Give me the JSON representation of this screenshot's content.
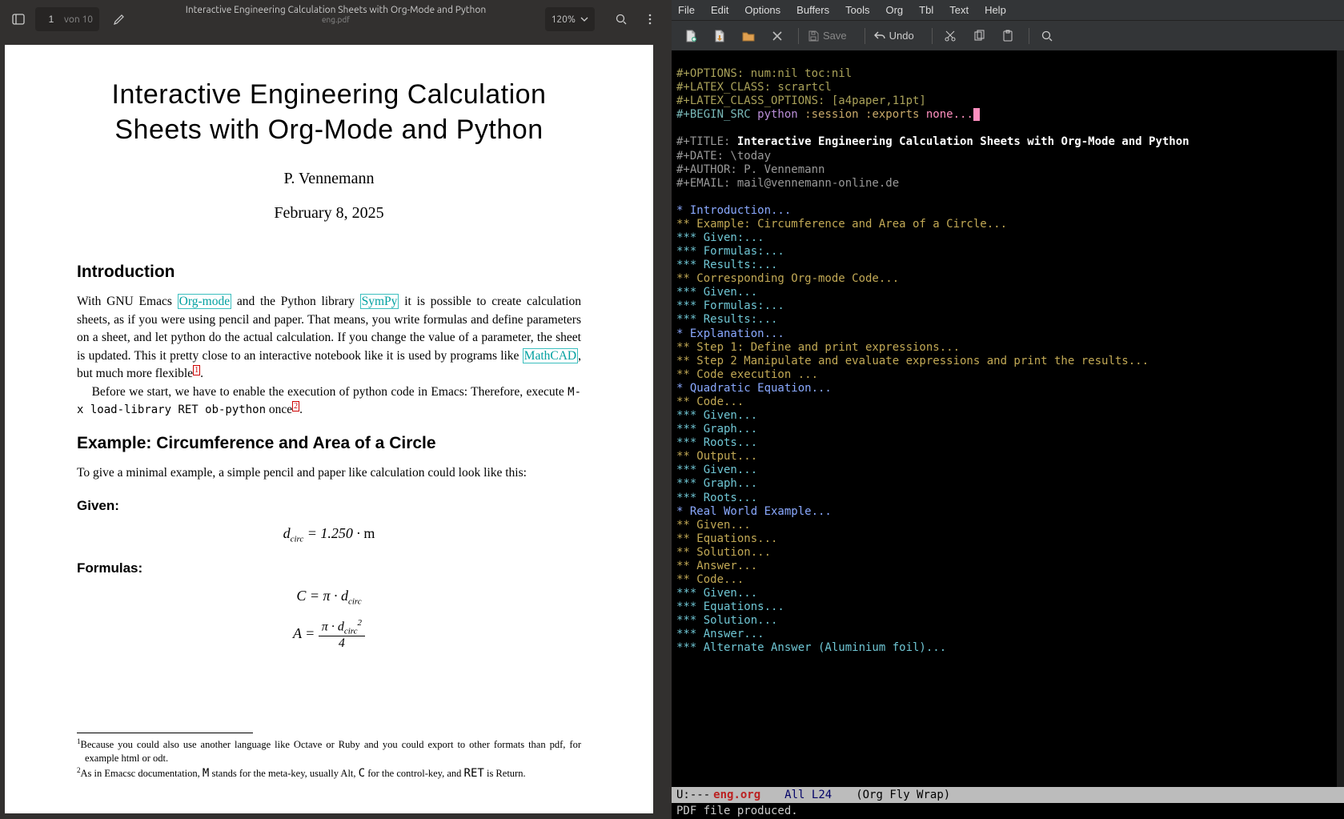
{
  "pdf": {
    "page_current": "1",
    "page_label": "von 10",
    "title": "Interactive Engineering Calculation Sheets with Org-Mode and Python",
    "filename": "eng.pdf",
    "zoom": "120%",
    "doc": {
      "title": "Interactive Engineering Calculation Sheets with Org-Mode and Python",
      "author": "P. Vennemann",
      "date": "February 8, 2025",
      "h_intro": "Introduction",
      "intro_p1_pre": "With GNU Emacs ",
      "link_org": "Org-mode",
      "intro_p1_mid": " and the Python library ",
      "link_sympy": "SymPy",
      "intro_p1_post": " it is possible to create calculation sheets, as if you were using pencil and paper. That means, you write formulas and define parameters on a sheet, and let python do the actual calculation. If you change the value of a parameter, the sheet is updated. This it pretty close to an interactive notebook like it is used by programs like ",
      "link_mathcad": "MathCAD",
      "intro_p1_tail": ", but much more flexible",
      "intro_p2": "Before we start, we have to enable the execution of python code in Emacs: Therefore, execute ",
      "intro_cmd": "M-x load-library RET ob-python",
      "intro_p2_tail": " once",
      "h_example": "Example: Circumference and Area of a Circle",
      "example_p": "To give a minimal example, a simple pencil and paper like calculation could look like this:",
      "h_given": "Given:",
      "h_formulas": "Formulas:",
      "fn1": "Because you could also use another language like Octave or Ruby and you could export to other formats than pdf, for example html or odt.",
      "fn2_pre": "As in Emacsc documentation, ",
      "fn2_m": "M",
      "fn2_mid1": " stands for the meta-key, usually Alt, ",
      "fn2_c": "C",
      "fn2_mid2": " for the control-key, and ",
      "fn2_ret": "RET",
      "fn2_tail": " is Return."
    }
  },
  "emacs": {
    "menu": [
      "File",
      "Edit",
      "Options",
      "Buffers",
      "Tools",
      "Org",
      "Tbl",
      "Text",
      "Help"
    ],
    "tb": {
      "save": "Save",
      "undo": "Undo"
    },
    "lines": {
      "opt": "#+OPTIONS: num:nil toc:nil",
      "lclass": "#+LATEX_CLASS: scrartcl",
      "lopts": "#+LATEX_CLASS_OPTIONS: [a4paper,11pt]",
      "bsrc_key": "#+BEGIN_SRC",
      "bsrc_lang": " python",
      "bsrc_args": " :session :exports",
      "bsrc_none": " none...",
      "title_key": "#+TITLE: ",
      "title_val": "Interactive Engineering Calculation Sheets with Org-Mode and Python",
      "date": "#+DATE: \\today",
      "author": "#+AUTHOR: P. Vennemann",
      "email": "#+EMAIL: mail@vennemann-online.de"
    },
    "outline": [
      {
        "lvl": 1,
        "t": "* Introduction..."
      },
      {
        "lvl": 2,
        "t": "** Example: Circumference and Area of a Circle..."
      },
      {
        "lvl": 3,
        "t": "*** Given:..."
      },
      {
        "lvl": 3,
        "t": "*** Formulas:..."
      },
      {
        "lvl": 3,
        "t": "*** Results:..."
      },
      {
        "lvl": 2,
        "t": "** Corresponding Org-mode Code..."
      },
      {
        "lvl": 3,
        "t": "*** Given..."
      },
      {
        "lvl": 3,
        "t": "*** Formulas:..."
      },
      {
        "lvl": 3,
        "t": "*** Results:..."
      },
      {
        "lvl": 1,
        "t": "* Explanation..."
      },
      {
        "lvl": 2,
        "t": "** Step 1: Define and print expressions..."
      },
      {
        "lvl": 2,
        "t": "** Step 2 Manipulate and evaluate expressions and print the results..."
      },
      {
        "lvl": 2,
        "t": "** Code execution ..."
      },
      {
        "lvl": 1,
        "t": "* Quadratic Equation..."
      },
      {
        "lvl": 2,
        "t": "** Code..."
      },
      {
        "lvl": 3,
        "t": "*** Given..."
      },
      {
        "lvl": 3,
        "t": "*** Graph..."
      },
      {
        "lvl": 3,
        "t": "*** Roots..."
      },
      {
        "lvl": 2,
        "t": "** Output..."
      },
      {
        "lvl": 3,
        "t": "*** Given..."
      },
      {
        "lvl": 3,
        "t": "*** Graph..."
      },
      {
        "lvl": 3,
        "t": "*** Roots..."
      },
      {
        "lvl": 1,
        "t": "* Real World Example..."
      },
      {
        "lvl": 2,
        "t": "** Given..."
      },
      {
        "lvl": 2,
        "t": "** Equations..."
      },
      {
        "lvl": 2,
        "t": "** Solution..."
      },
      {
        "lvl": 2,
        "t": "** Answer..."
      },
      {
        "lvl": 2,
        "t": "** Code..."
      },
      {
        "lvl": 3,
        "t": "*** Given..."
      },
      {
        "lvl": 3,
        "t": "*** Equations..."
      },
      {
        "lvl": 3,
        "t": "*** Solution..."
      },
      {
        "lvl": 3,
        "t": "*** Answer..."
      },
      {
        "lvl": 3,
        "t": "*** Alternate Answer (Aluminium foil)..."
      }
    ],
    "modeline": {
      "left": "U:---",
      "file": "eng.org",
      "pos": "All L24",
      "modes": "(Org Fly Wrap)"
    },
    "minibuffer": "PDF file produced."
  }
}
